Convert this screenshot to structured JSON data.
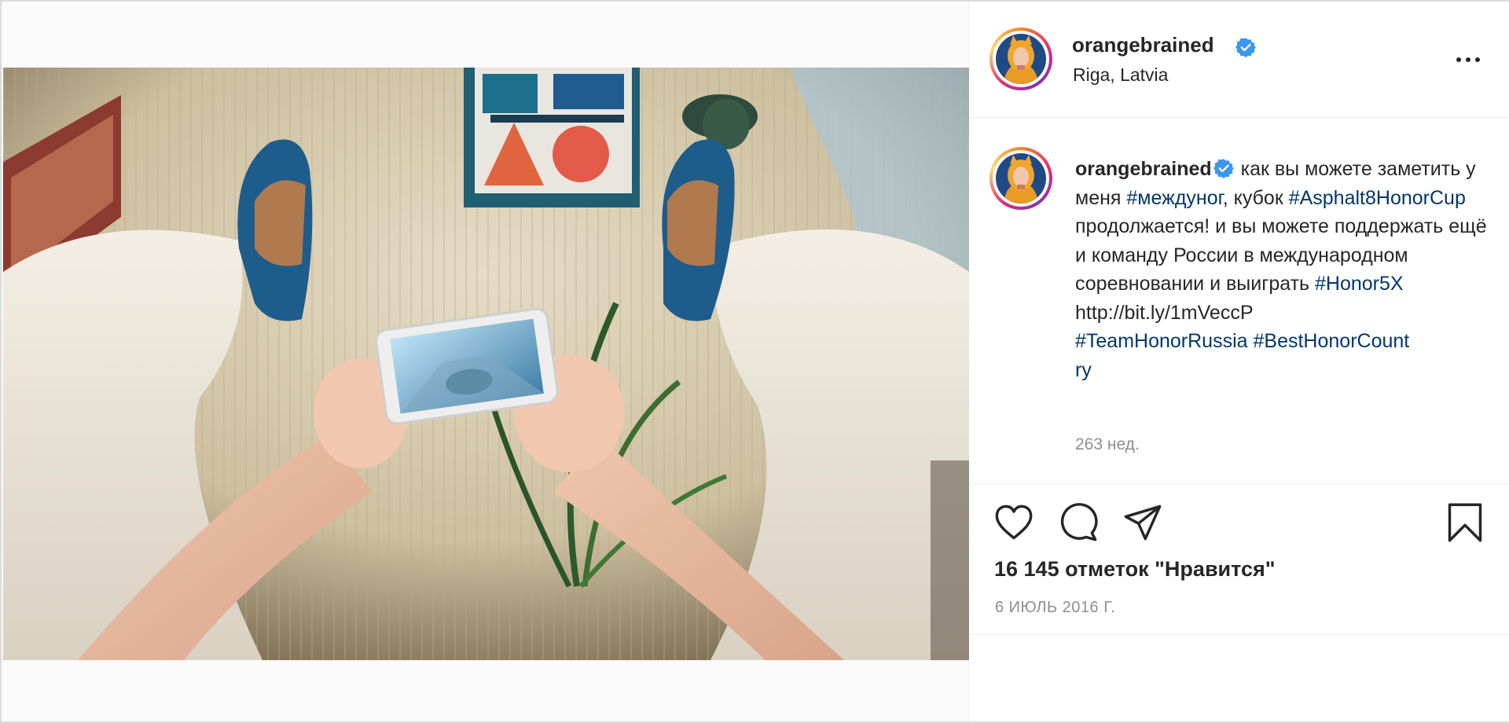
{
  "post": {
    "username": "orangebrained",
    "location": "Riga, Latvia",
    "caption": {
      "username": "orangebrained",
      "part1": " как вы можете заметить у меня ",
      "tag1": "#междуног",
      "part2": ", кубок ",
      "tag2": "#Asphalt8HonorCup",
      "part3": " продолжается! и вы можете поддержать ещё и команду России в международном соревновании и выиграть ",
      "tag3": "#Honor5X",
      "link": "http://bit.ly/1mVeccP",
      "tag4": "#TeamHonorRussia",
      "tag5": "#BestHonorCount",
      "tag5_tail": "ry"
    },
    "posted_ago": "263 нед.",
    "likes": "16 145 отметок \"Нравится\"",
    "date": "6 ИЮЛЬ 2016 Г."
  },
  "icons": {
    "verified": "verified-badge-icon",
    "more": "more-options-icon",
    "like": "heart-icon",
    "comment": "comment-icon",
    "share": "paper-plane-icon",
    "save": "bookmark-icon"
  },
  "colors": {
    "hashtag": "#00376b",
    "verified": "#3897f0",
    "muted": "#8e8e8e"
  }
}
